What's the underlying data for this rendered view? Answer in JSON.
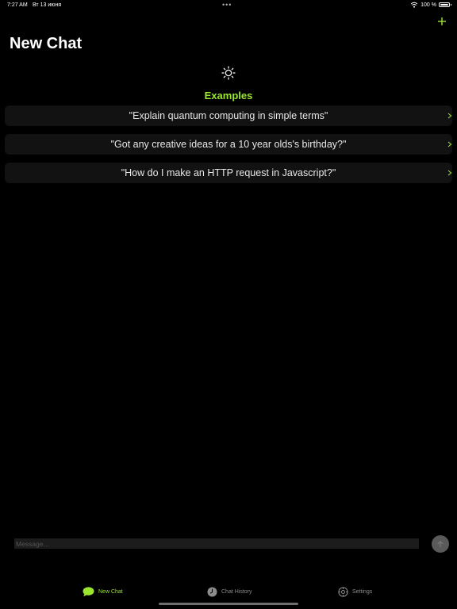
{
  "status_bar": {
    "time": "7:27 AM",
    "date": "Вт 13 июня",
    "dots": "•••",
    "battery": "100 %"
  },
  "header": {
    "title": "New Chat",
    "add_icon": "plus-icon"
  },
  "examples": {
    "title": "Examples",
    "icon": "sun-icon",
    "items": [
      "\"Explain quantum computing in simple terms\"",
      "\"Got any creative ideas for a 10 year olds's birthday?\"",
      "\"How do I make an HTTP request in Javascript?\""
    ]
  },
  "composer": {
    "placeholder": "Message...",
    "value": ""
  },
  "tabs": [
    {
      "label": "New Chat",
      "icon": "chat-bubble-icon",
      "active": true
    },
    {
      "label": "Chat History",
      "icon": "clock-icon",
      "active": false
    },
    {
      "label": "Settings",
      "icon": "gear-icon",
      "active": false
    }
  ],
  "colors": {
    "accent": "#9ae62f",
    "background": "#000000",
    "card": "#121212",
    "inactive": "#8c8c8c"
  }
}
